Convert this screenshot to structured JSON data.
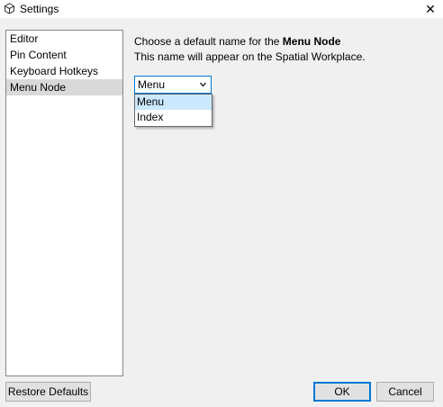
{
  "window": {
    "title": "Settings",
    "close_glyph": "✕"
  },
  "sidebar": {
    "items": [
      {
        "label": "Editor"
      },
      {
        "label": "Pin Content"
      },
      {
        "label": "Keyboard Hotkeys"
      },
      {
        "label": "Menu Node",
        "selected": true
      }
    ]
  },
  "content": {
    "prompt_prefix": "Choose a default name for the ",
    "prompt_bold": "Menu Node",
    "description": "This name will appear on the Spatial Workplace."
  },
  "combo": {
    "value": "Menu",
    "options": [
      "Menu",
      "Index"
    ],
    "highlighted": "Menu"
  },
  "buttons": {
    "restore": "Restore Defaults",
    "ok": "OK",
    "cancel": "Cancel"
  },
  "icons": {
    "app": "cube-icon",
    "close": "close-icon",
    "dropdown": "chevron-down-icon"
  },
  "colors": {
    "accent": "#0078d7",
    "selection": "#d9d9d9",
    "highlight": "#cce8ff",
    "background": "#f0f0f0"
  }
}
